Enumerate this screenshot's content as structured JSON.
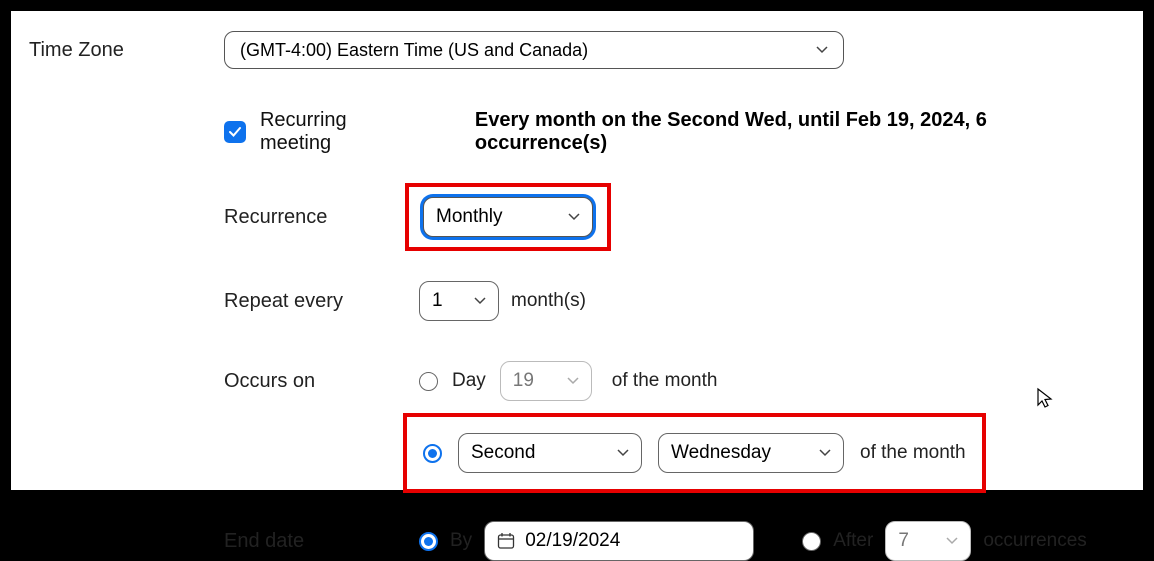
{
  "timezone": {
    "label": "Time Zone",
    "value": "(GMT-4:00) Eastern Time (US and Canada)"
  },
  "recurring": {
    "checkbox_label": "Recurring meeting",
    "summary": "Every month on the Second Wed, until Feb 19, 2024, 6 occurrence(s)"
  },
  "recurrence": {
    "label": "Recurrence",
    "value": "Monthly"
  },
  "repeat": {
    "label": "Repeat every",
    "value": "1",
    "unit": "month(s)"
  },
  "occurs": {
    "label": "Occurs on",
    "day_label": "Day",
    "day_value": "19",
    "of_month": "of the month",
    "ordinal": "Second",
    "weekday": "Wednesday"
  },
  "end": {
    "label": "End date",
    "by_label": "By",
    "by_date": "02/19/2024",
    "after_label": "After",
    "after_value": "7",
    "occurrences_label": "occurrences"
  }
}
